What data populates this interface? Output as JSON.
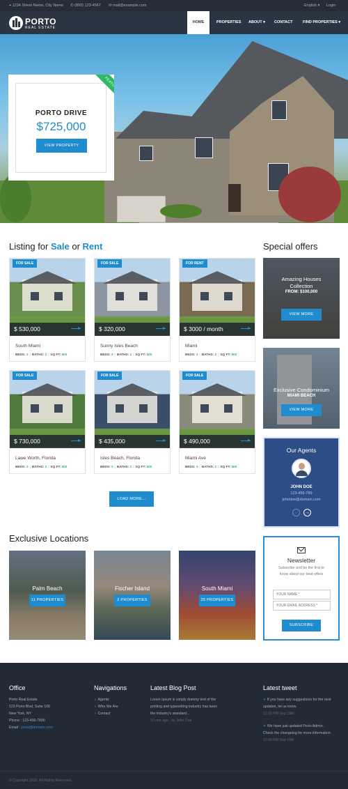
{
  "topbar": {
    "address": "1234 Street Name, City Name",
    "phone": "(800) 123-4567",
    "email": "mail@example.com",
    "language": "English ▾",
    "login": "Login"
  },
  "nav": {
    "brand": "PORTO",
    "brand_sub": "REAL ESTATE",
    "items": [
      "HOME",
      "PROPERTIES",
      "ABOUT ▾",
      "CONTACT",
      "FIND PROPERTIES ▾"
    ]
  },
  "featured": {
    "ribbon": "FEATURED",
    "title": "PORTO DRIVE",
    "price": "$725,000",
    "button": "VIEW PROPERTY"
  },
  "listing": {
    "title_pre": "Listing for ",
    "title_sale": "Sale",
    "title_or": " or ",
    "title_rent": "Rent",
    "load_more": "LOAD MORE...",
    "cards": [
      {
        "tag": "FOR SALE",
        "price": "$ 530,000",
        "location": "South Miami",
        "beds": "3",
        "baths": "2",
        "sqft": "500",
        "img": "#6a8e4e"
      },
      {
        "tag": "FOR SALE",
        "price": "$ 320,000",
        "location": "Sunny Isles Beach",
        "beds": "3",
        "baths": "2",
        "sqft": "500",
        "img": "#8c96a0"
      },
      {
        "tag": "FOR RENT",
        "price": "$ 3000 / month",
        "location": "Miami",
        "beds": "3",
        "baths": "2",
        "sqft": "500",
        "img": "#7b6a52"
      },
      {
        "tag": "FOR SALE",
        "price": "$ 730,000",
        "location": "Lawe Worth, Florida",
        "beds": "3",
        "baths": "2",
        "sqft": "500",
        "img": "#4f7a3c"
      },
      {
        "tag": "FOR SALE",
        "price": "$ 435,000",
        "location": "Isles Beach, Florida",
        "beds": "3",
        "baths": "2",
        "sqft": "500",
        "img": "#3a4e6a"
      },
      {
        "tag": "FOR SALE",
        "price": "$ 490,000",
        "location": "Miami Ave",
        "beds": "3",
        "baths": "2",
        "sqft": "500",
        "img": "#8a8a7c"
      }
    ],
    "beds_label": "BEDS:",
    "baths_label": "BATHS:",
    "sqft_label": "SQ FT:"
  },
  "offers": {
    "title": "Special offers",
    "items": [
      {
        "line1": "Amazing Houses",
        "line2": "Collection",
        "line3": "FROM: $100,000",
        "button": "VIEW MORE"
      },
      {
        "line1": "Exclusive Condominium",
        "line2": "MIAMI BEACH",
        "button": "VIEW MORE"
      }
    ]
  },
  "agents": {
    "title": "Our Agents",
    "name": "JOHN DOE",
    "phone": "123-456-789",
    "email": "johndoe@domain.com"
  },
  "newsletter": {
    "title": "Newsletter",
    "text1": "Subscribe and be the first to",
    "text2": "know about our best offers",
    "name_placeholder": "YOUR NAME *",
    "email_placeholder": "YOUR EMAIL ADDRESS *",
    "button": "SUBSCRIBE"
  },
  "exclusive": {
    "title": "Exclusive Locations",
    "items": [
      {
        "name": "Palm Beach",
        "count": "11 PROPERTIES"
      },
      {
        "name": "Fischer Island",
        "count": "2 PROPERTIES"
      },
      {
        "name": "South Miami",
        "count": "25 PROPERTIES"
      }
    ]
  },
  "footer": {
    "office_title": "Office",
    "office_lines": [
      "Porto Real Estate",
      "123 Porto Blvd, Suite 100",
      "New York, NY"
    ],
    "office_phone": "Phone : 123-456-7890",
    "office_email_label": "Email : ",
    "office_email": "porto@domain.com",
    "nav_title": "Navigations",
    "nav_items": [
      "Agents",
      "Who We Are",
      "Contact"
    ],
    "blog_title": "Latest Blog Post",
    "blog_lines": [
      "Lorem Ipsum is simply dummy text of the",
      "printing and typesetting industry has been",
      "the industry's standard..."
    ],
    "blog_meta": "10 min ago - by John Doe",
    "tweet_title": "Latest tweet",
    "tweets": [
      {
        "l1": "If you have any suggestions for the next",
        "l2": "updates, let us know.",
        "time": "12:00 PM Sep 19th"
      },
      {
        "l1": "We have just updated Porto Admin.",
        "l2": "Check the changelog for more information.",
        "time": "12:00 PM Sep 19th"
      }
    ],
    "copyright": "© Copyright 2016. All Rights Reserved."
  }
}
